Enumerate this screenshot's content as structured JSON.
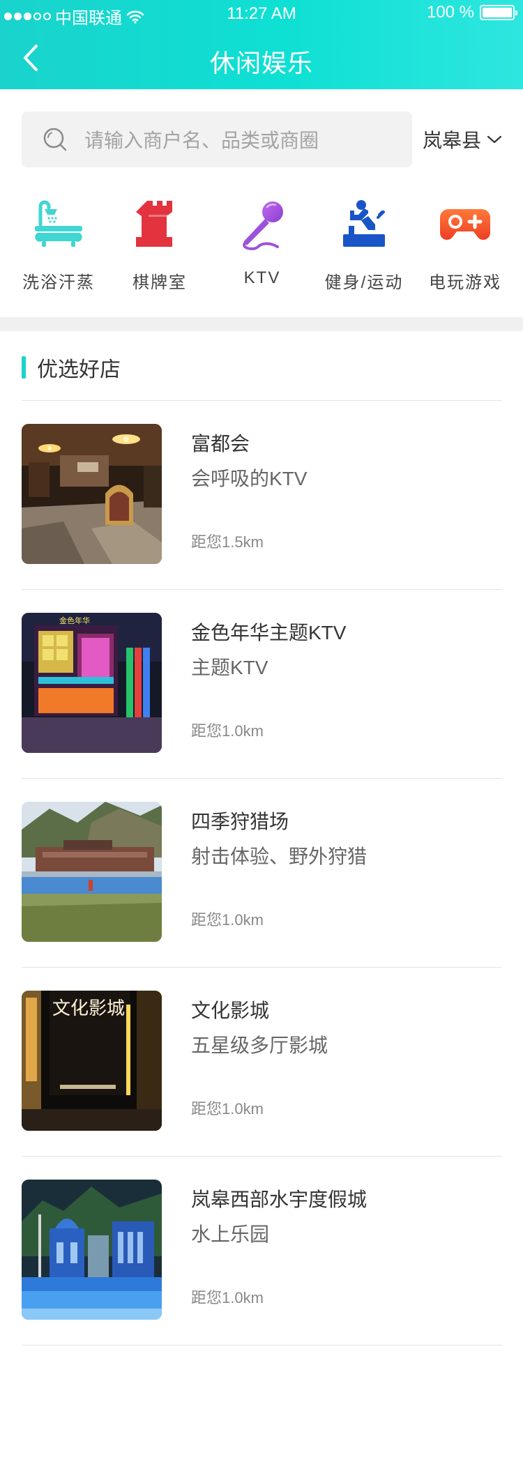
{
  "status_bar": {
    "carrier": "中国联通",
    "time": "11:27 AM",
    "battery": "100 %",
    "battery_level": 1.0
  },
  "nav": {
    "title": "休闲娱乐"
  },
  "search": {
    "placeholder": "请输入商户名、品类或商圈",
    "county": "岚皋县"
  },
  "categories": [
    {
      "label": "洗浴汗蒸",
      "icon": "bathtub-icon",
      "color": "#3fd6d3"
    },
    {
      "label": "棋牌室",
      "icon": "chess-rook-icon",
      "color": "#e2333f"
    },
    {
      "label": "KTV",
      "icon": "microphone-icon",
      "color": "#a35ad8"
    },
    {
      "label": "健身/运动",
      "icon": "fitness-icon",
      "color": "#1a55c8"
    },
    {
      "label": "电玩游戏",
      "icon": "gamepad-icon",
      "color": "#f25a2a"
    }
  ],
  "section": {
    "title": "优选好店",
    "accent": "#19d3cc"
  },
  "shops": [
    {
      "name": "富都会",
      "desc": "会呼吸的KTV",
      "distance": "距您1.5km",
      "image": "ktv-lobby-photo"
    },
    {
      "name": "金色年华主题KTV",
      "desc": "主题KTV",
      "distance": "距您1.0km",
      "image": "ktv-storefront-photo",
      "sign_text": "金色年华"
    },
    {
      "name": "四季狩猎场",
      "desc": "射击体验、野外狩猎",
      "distance": "距您1.0km",
      "image": "hunting-ground-photo"
    },
    {
      "name": "文化影城",
      "desc": "五星级多厅影城",
      "distance": "距您1.0km",
      "image": "cinema-sign-photo",
      "sign_text": "文化影城"
    },
    {
      "name": "岚皋西部水宇度假城",
      "desc": "水上乐园",
      "distance": "距您1.0km",
      "image": "water-park-photo"
    }
  ]
}
